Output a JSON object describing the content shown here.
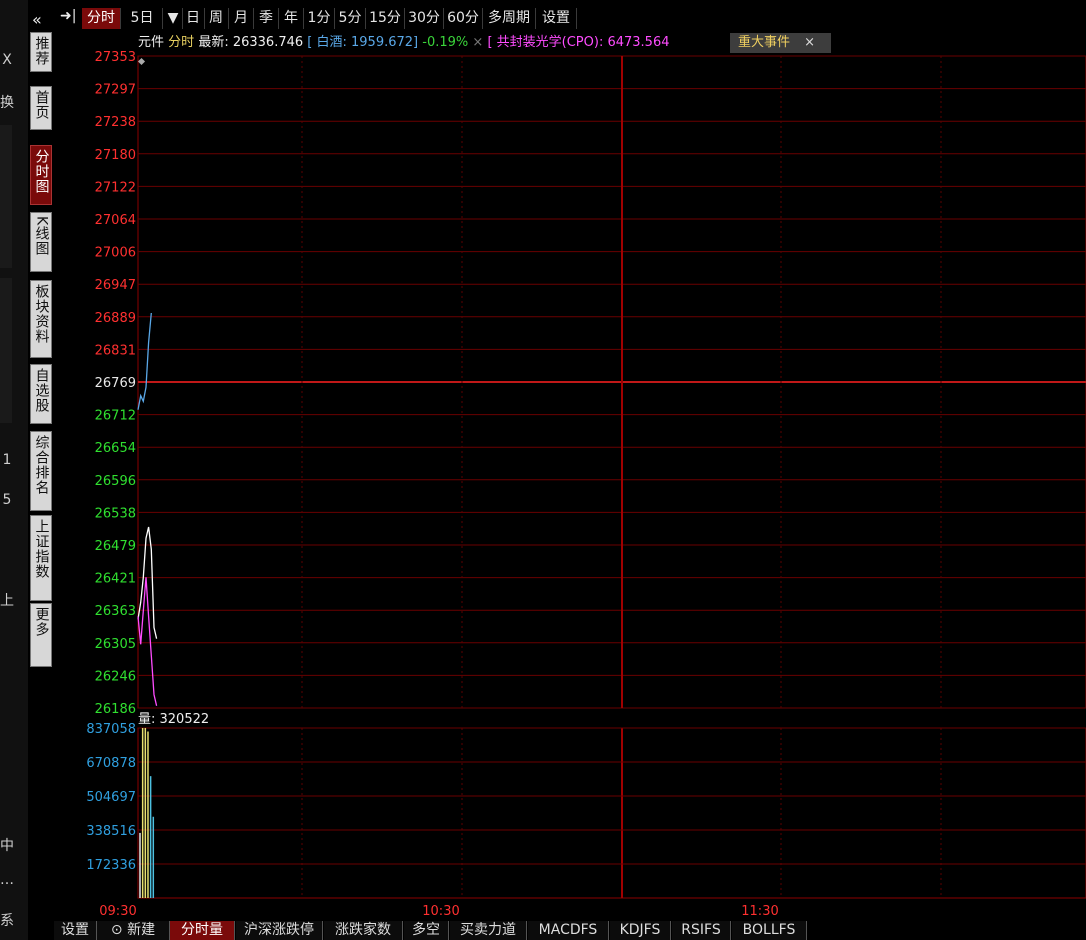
{
  "left_strip": {
    "chars": [
      "X",
      "换",
      "1",
      "5",
      "上",
      "中",
      "…",
      "系"
    ]
  },
  "vertical_tabs": [
    {
      "label": "推荐",
      "active": false
    },
    {
      "label": "首页",
      "active": false
    },
    {
      "label": "分时图",
      "active": true
    },
    {
      "label": "K线图",
      "active": false
    },
    {
      "label": "板块资料",
      "active": false
    },
    {
      "label": "自选股",
      "active": false
    },
    {
      "label": "综合排名",
      "active": false
    },
    {
      "label": "上证指数",
      "active": false
    },
    {
      "label": "更多",
      "active": false
    }
  ],
  "collapse_glyph": "«",
  "toolbar": {
    "pin_glyph": "➜|",
    "items": [
      {
        "label": "分时",
        "active": true
      },
      {
        "label": "5日",
        "active": false
      },
      {
        "label": "▼",
        "active": false
      },
      {
        "label": "日",
        "active": false
      },
      {
        "label": "周",
        "active": false
      },
      {
        "label": "月",
        "active": false
      },
      {
        "label": "季",
        "active": false
      },
      {
        "label": "年",
        "active": false
      },
      {
        "label": "1分",
        "active": false
      },
      {
        "label": "5分",
        "active": false
      },
      {
        "label": "15分",
        "active": false
      },
      {
        "label": "30分",
        "active": false
      },
      {
        "label": "60分",
        "active": false
      },
      {
        "label": "多周期",
        "active": false
      },
      {
        "label": "设置",
        "active": false
      }
    ]
  },
  "info": {
    "name": "元件",
    "mode": "分时",
    "latest_label": "最新:",
    "latest_value": "26336.746",
    "compare1": "[ 白酒: 1959.672]",
    "change": "-0.19%",
    "close1": "×",
    "compare2": "[ 共封装光学(CPO): 6473.564",
    "event_button": "重大事件",
    "event_close": "×"
  },
  "price_axis": {
    "labels": [
      "27353",
      "27297",
      "27238",
      "27180",
      "27122",
      "27064",
      "27006",
      "26947",
      "26889",
      "26831",
      "26769",
      "26712",
      "26654",
      "26596",
      "26538",
      "26479",
      "26421",
      "26363",
      "26305",
      "26246",
      "26186"
    ]
  },
  "volume_panel": {
    "label": "量: 320522",
    "labels": [
      "837058",
      "670878",
      "504697",
      "338516",
      "172336"
    ]
  },
  "time_axis": [
    "09:30",
    "10:30",
    "11:30"
  ],
  "bottom_tabs": [
    {
      "label": "设置",
      "active": false
    },
    {
      "label": "⊙ 新建",
      "active": false
    },
    {
      "label": "分时量",
      "active": true
    },
    {
      "label": "沪深涨跌停",
      "active": false
    },
    {
      "label": "涨跌家数",
      "active": false
    },
    {
      "label": "多空",
      "active": false
    },
    {
      "label": "买卖力道",
      "active": false
    },
    {
      "label": "MACDFS",
      "active": false
    },
    {
      "label": "KDJFS",
      "active": false
    },
    {
      "label": "RSIFS",
      "active": false
    },
    {
      "label": "BOLLFS",
      "active": false
    }
  ],
  "chart_data": {
    "type": "line",
    "price_ylim": [
      26186,
      27353
    ],
    "prev_close": 26769,
    "series": [
      {
        "name": "元件",
        "color": "#ffffff",
        "minutes": [
          0,
          1,
          2,
          3,
          4,
          5,
          6,
          7
        ],
        "values": [
          26345,
          26375,
          26420,
          26490,
          26510,
          26470,
          26330,
          26310
        ]
      },
      {
        "name": "白酒",
        "color": "#5aa8e8",
        "minutes": [
          0,
          1,
          2,
          3,
          4,
          5
        ],
        "values": [
          26720,
          26745,
          26735,
          26760,
          26840,
          26893
        ]
      },
      {
        "name": "共封装光学(CPO)",
        "color": "#ff4cff",
        "minutes": [
          0,
          1,
          2,
          3,
          4,
          5,
          6,
          7
        ],
        "values": [
          26350,
          26300,
          26360,
          26420,
          26350,
          26280,
          26210,
          26190
        ]
      }
    ],
    "volume_ylim": [
      0,
      837058
    ],
    "volume": [
      {
        "minute": 0,
        "value": 320522,
        "color": "#e8e8e8"
      },
      {
        "minute": 1,
        "value": 837058,
        "color": "#e8e070"
      },
      {
        "minute": 2,
        "value": 837058,
        "color": "#e8e070"
      },
      {
        "minute": 3,
        "value": 820000,
        "color": "#e8e070"
      },
      {
        "minute": 4,
        "value": 600000,
        "color": "#4cc0e0"
      },
      {
        "minute": 5,
        "value": 400000,
        "color": "#4cc0e0"
      }
    ]
  }
}
